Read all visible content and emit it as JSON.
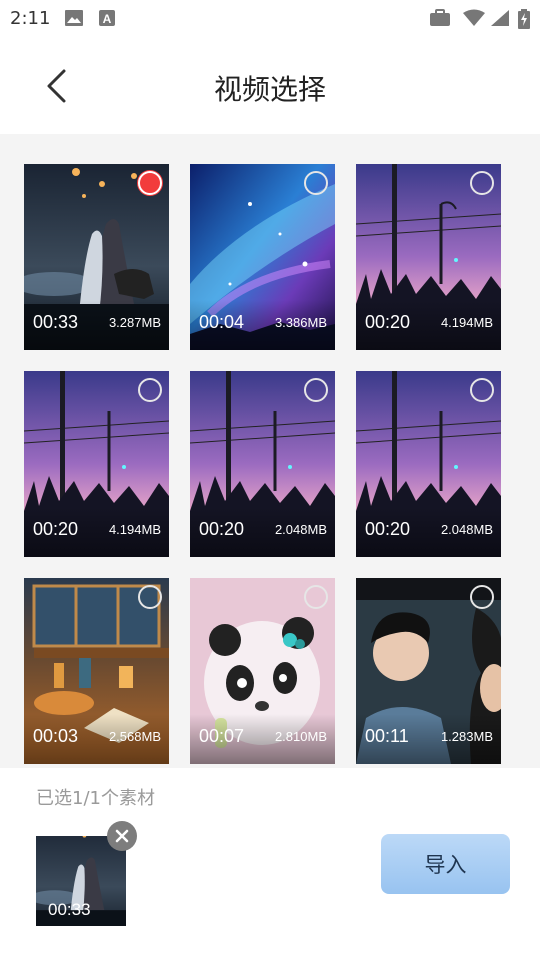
{
  "status_bar": {
    "time": "2:11",
    "icons": [
      "image-icon",
      "font-a-icon",
      "briefcase-icon",
      "wifi-icon",
      "signal-icon",
      "battery-charging-icon"
    ]
  },
  "header": {
    "title": "视频选择",
    "back_icon": "chevron-left-icon"
  },
  "videos": [
    {
      "duration": "00:33",
      "size": "3.287MB",
      "selected": true,
      "scene": "lantern-night"
    },
    {
      "duration": "00:04",
      "size": "3.386MB",
      "selected": false,
      "scene": "galaxy"
    },
    {
      "duration": "00:20",
      "size": "4.194MB",
      "selected": false,
      "scene": "purple-street"
    },
    {
      "duration": "00:20",
      "size": "4.194MB",
      "selected": false,
      "scene": "purple-street"
    },
    {
      "duration": "00:20",
      "size": "2.048MB",
      "selected": false,
      "scene": "purple-street"
    },
    {
      "duration": "00:20",
      "size": "2.048MB",
      "selected": false,
      "scene": "purple-street"
    },
    {
      "duration": "00:03",
      "size": "2.568MB",
      "selected": false,
      "scene": "cozy-room"
    },
    {
      "duration": "00:07",
      "size": "2.810MB",
      "selected": false,
      "scene": "panda"
    },
    {
      "duration": "00:11",
      "size": "1.283MB",
      "selected": false,
      "scene": "portrait"
    }
  ],
  "bottom": {
    "selected_count_text": "已选1/1个素材",
    "thumb_duration": "00:33",
    "import_label": "导入",
    "remove_icon": "close-icon"
  },
  "colors": {
    "selected_red": "#f23c3c",
    "import_button": "#a9cef3",
    "grid_background": "#f4f4f4"
  }
}
